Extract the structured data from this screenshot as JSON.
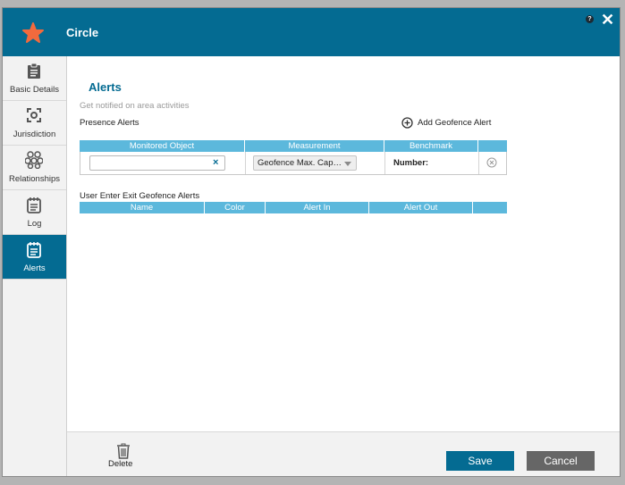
{
  "header": {
    "title": "Circle",
    "help_label": "?",
    "close_label": "✕"
  },
  "sidebar": {
    "items": [
      {
        "label": "Basic Details",
        "icon": "clipboard-icon"
      },
      {
        "label": "Jurisdiction",
        "icon": "target-icon"
      },
      {
        "label": "Relationships",
        "icon": "relationships-icon"
      },
      {
        "label": "Log",
        "icon": "log-icon"
      },
      {
        "label": "Alerts",
        "icon": "alerts-icon",
        "active": true
      }
    ]
  },
  "alerts": {
    "title": "Alerts",
    "subtitle": "Get notified on area activities",
    "presence_label": "Presence Alerts",
    "add_geofence_label": "Add Geofence Alert",
    "presence_table": {
      "columns": [
        "Monitored Object",
        "Measurement",
        "Benchmark",
        ""
      ],
      "row": {
        "monitored_object_value": "",
        "clear_label": "×",
        "measurement_value": "Geofence Max. Cap…",
        "benchmark_label": "Number:"
      }
    },
    "user_enter_exit_label": "User Enter Exit Geofence Alerts",
    "enter_exit_table": {
      "columns": [
        "Name",
        "Color",
        "Alert In",
        "Alert Out",
        ""
      ]
    }
  },
  "footer": {
    "delete_label": "Delete",
    "save_label": "Save",
    "cancel_label": "Cancel"
  },
  "colors": {
    "primary": "#046b92",
    "table_header": "#5cb8dc",
    "cancel": "#666666",
    "star": "#f26a3d"
  }
}
